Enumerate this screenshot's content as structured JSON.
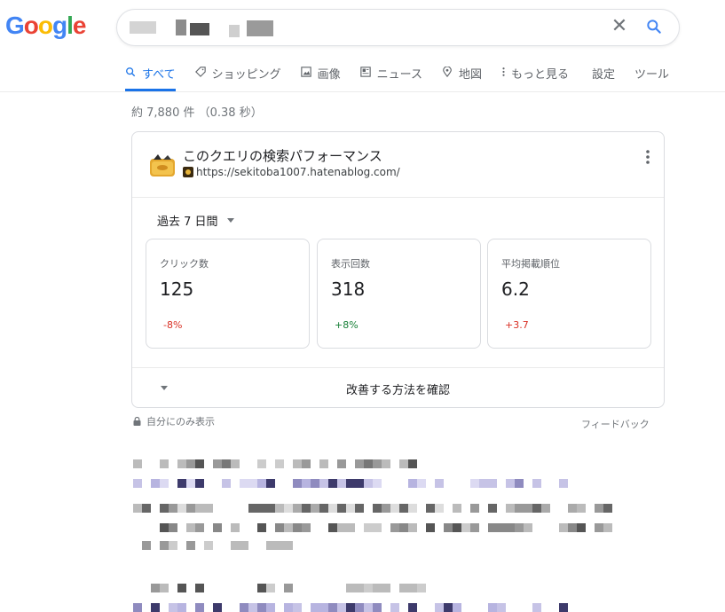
{
  "logo": {
    "letters": [
      {
        "ch": "G",
        "color": "#4285f4"
      },
      {
        "ch": "o",
        "color": "#ea4335"
      },
      {
        "ch": "o",
        "color": "#fbbc05"
      },
      {
        "ch": "g",
        "color": "#4285f4"
      },
      {
        "ch": "l",
        "color": "#34a853"
      },
      {
        "ch": "e",
        "color": "#ea4335"
      }
    ]
  },
  "search": {
    "clear_icon": "close-icon",
    "search_icon": "search-icon"
  },
  "tabs": [
    {
      "label": "すべて",
      "icon": "search-icon",
      "active": true
    },
    {
      "label": "ショッピング",
      "icon": "tag-icon",
      "active": false
    },
    {
      "label": "画像",
      "icon": "image-icon",
      "active": false
    },
    {
      "label": "ニュース",
      "icon": "news-icon",
      "active": false
    },
    {
      "label": "地図",
      "icon": "map-pin-icon",
      "active": false
    },
    {
      "label": "もっと見る",
      "icon": "more-vert-icon",
      "active": false
    },
    {
      "label": "設定",
      "icon": "",
      "active": false
    },
    {
      "label": "ツール",
      "icon": "",
      "active": false
    }
  ],
  "result_stats": "約 7,880 件 （0.38 秒）",
  "card": {
    "title": "このクエリの検索パフォーマンス",
    "url": "https://sekitoba1007.hatenablog.com/",
    "period": "過去 7 日間",
    "metrics": [
      {
        "label": "クリック数",
        "value": "125",
        "delta": "-8%",
        "delta_color": "#d93025"
      },
      {
        "label": "表示回数",
        "value": "318",
        "delta": "+8%",
        "delta_color": "#188038"
      },
      {
        "label": "平均掲載順位",
        "value": "6.2",
        "delta": "+3.7",
        "delta_color": "#d93025"
      }
    ],
    "improve_link": "改善する方法を確認"
  },
  "private_note": "自分にのみ表示",
  "feedback": "フィードバック"
}
